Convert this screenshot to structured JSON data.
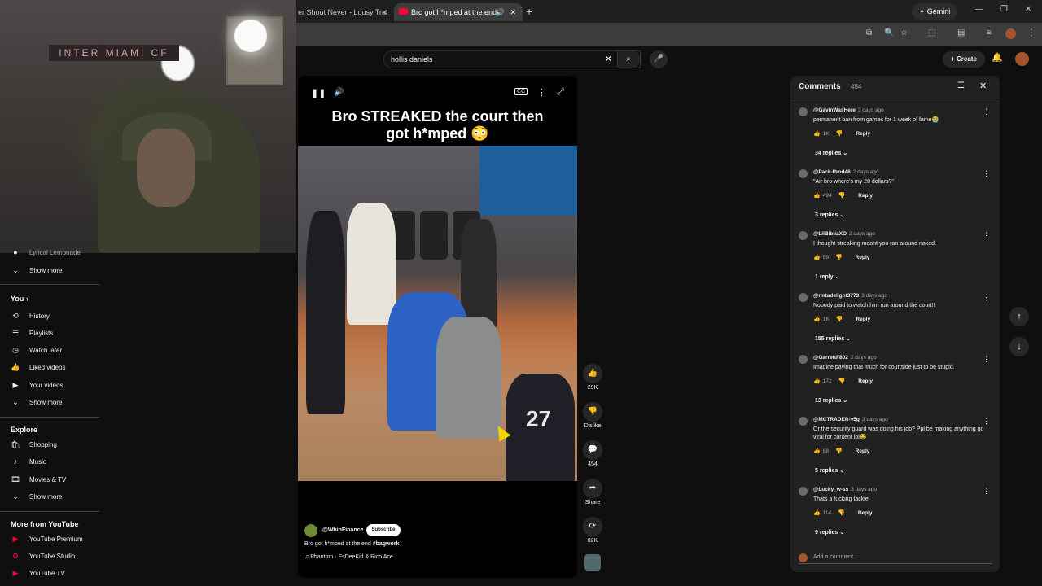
{
  "browser": {
    "tabs": [
      {
        "label": "er Shout Never - Lousy Trut",
        "active": false
      },
      {
        "label": "Bro got h*mped at the end",
        "active": true
      }
    ],
    "gemini_label": "Gemini"
  },
  "header": {
    "search_value": "hollis daniels",
    "create_label": "Create"
  },
  "sidebar": {
    "partial_item": "Lyrical Lemonade",
    "show_more_1": "Show more",
    "you_heading": "You",
    "you_items": [
      {
        "label": "History",
        "icon": "history-icon"
      },
      {
        "label": "Playlists",
        "icon": "playlists-icon"
      },
      {
        "label": "Watch later",
        "icon": "watch-later-icon"
      },
      {
        "label": "Liked videos",
        "icon": "liked-videos-icon"
      },
      {
        "label": "Your videos",
        "icon": "your-videos-icon"
      }
    ],
    "show_more_2": "Show more",
    "explore_heading": "Explore",
    "explore_items": [
      {
        "label": "Shopping",
        "icon": "shopping-icon"
      },
      {
        "label": "Music",
        "icon": "music-icon"
      },
      {
        "label": "Movies & TV",
        "icon": "movies-icon"
      }
    ],
    "show_more_3": "Show more",
    "more_heading": "More from YouTube",
    "more_items": [
      {
        "label": "YouTube Premium",
        "icon": "youtube-premium-icon"
      },
      {
        "label": "YouTube Studio",
        "icon": "youtube-studio-icon"
      },
      {
        "label": "YouTube TV",
        "icon": "youtube-tv-icon"
      }
    ]
  },
  "webcam": {
    "banner_text": "INTER MIAMI CF"
  },
  "short": {
    "caption_line1": "Bro STREAKED the court then",
    "caption_line2": "got h*mped 😳",
    "jersey_number": "27",
    "channel": "@WhinFinance",
    "subscribe_label": "Subscribe",
    "title": "Bro got h*mped at the end",
    "hashtag": "#bagwork",
    "music": "Phantom · EsDeeKid & Rico Ace",
    "actions": {
      "likes": "29K",
      "dislike_label": "Dislike",
      "comments": "454",
      "share_label": "Share",
      "remixes": "82K"
    }
  },
  "comments": {
    "title": "Comments",
    "count": "454",
    "add_placeholder": "Add a comment...",
    "items": [
      {
        "author": "@GavinWasHere",
        "time": "3 days ago",
        "text": "permanent ban from games for 1 week of fame😭",
        "likes": "1K",
        "replies": "34 replies"
      },
      {
        "author": "@Pack-Prod46",
        "time": "2 days ago",
        "text": "\"Air bro where's my 20 dollars?\"",
        "likes": "494",
        "replies": "3 replies"
      },
      {
        "author": "@LilBibliaXO",
        "time": "2 days ago",
        "text": "I thought streaking meant you ran around naked.",
        "likes": "59",
        "replies": "1 reply"
      },
      {
        "author": "@rmtadelight3773",
        "time": "3 days ago",
        "text": "Nobody paid to watch him run around the court!!",
        "likes": "1K",
        "replies": "155 replies"
      },
      {
        "author": "@GarrettF802",
        "time": "2 days ago",
        "text": "Imagine paying that much for courtside just to be stupid.",
        "likes": "172",
        "replies": "13 replies"
      },
      {
        "author": "@MCTRADER-v5g",
        "time": "3 days ago",
        "text": "Or the security guard was doing his job? Ppl be making anything go viral for content lol😂",
        "likes": "68",
        "replies": "5 replies"
      },
      {
        "author": "@Lucky_w-ss",
        "time": "3 days ago",
        "text": "Thats a fucking tackle",
        "likes": "114",
        "replies": "9 replies"
      }
    ],
    "reply_label": "Reply"
  }
}
